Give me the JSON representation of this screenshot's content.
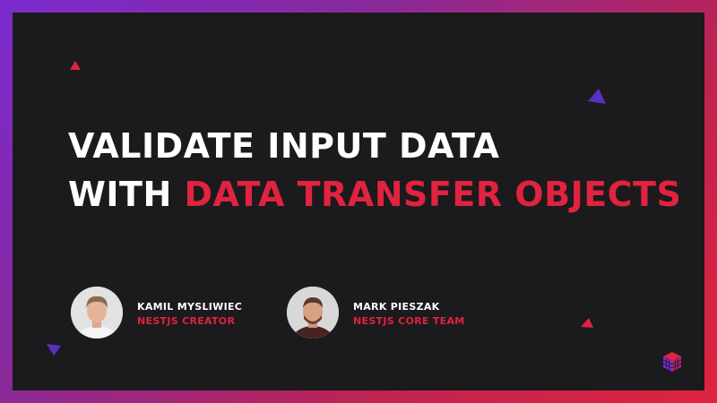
{
  "title": {
    "line1": "VALIDATE INPUT DATA",
    "line2_prefix": "WITH ",
    "line2_accent": "DATA TRANSFER OBJECTS"
  },
  "speakers": [
    {
      "name": "KAMIL MYSLIWIEC",
      "role": "NESTJS CREATOR",
      "avatar": "avatar-photo"
    },
    {
      "name": "MARK PIESZAK",
      "role": "NESTJS CORE TEAM",
      "avatar": "avatar-photo"
    }
  ],
  "colors": {
    "background": "#1b1a1c",
    "title": "#ffffff",
    "accent": "#e0233f",
    "triangle_red": "#e0233f",
    "triangle_purple": "#5b2fc4"
  },
  "icons": [
    "triangle-icon",
    "cube-logo-icon"
  ]
}
